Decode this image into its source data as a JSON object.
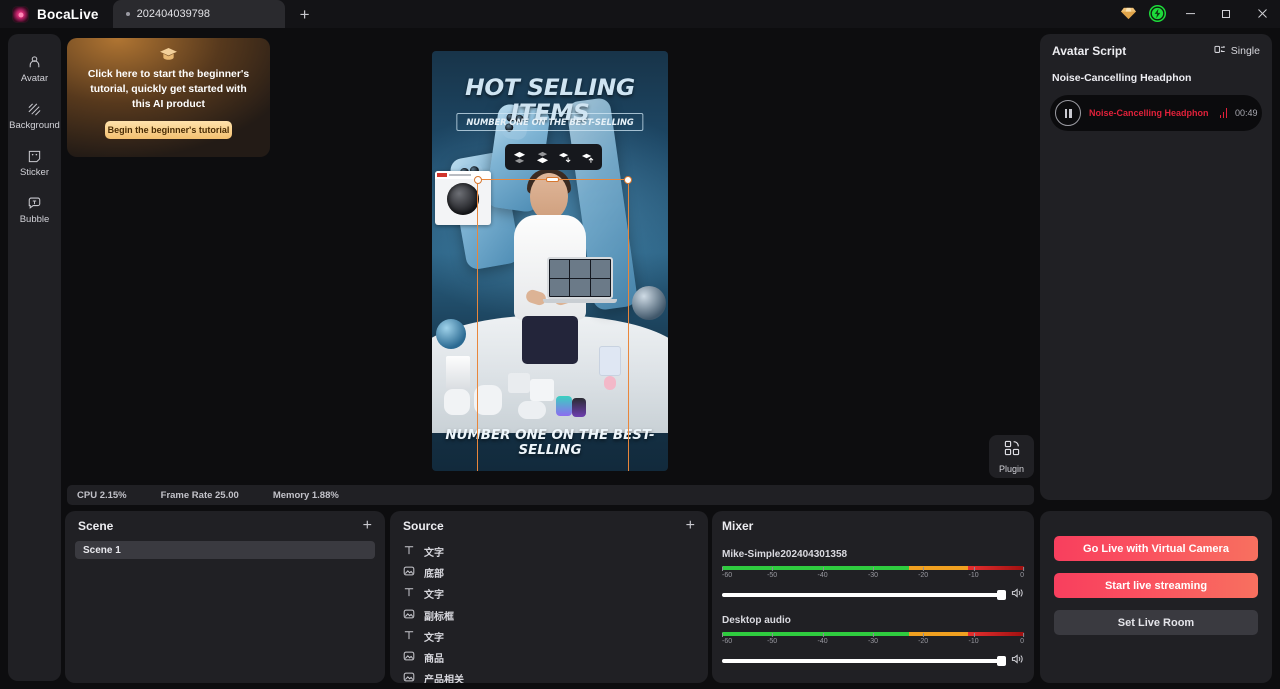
{
  "app": {
    "brand": "BocaLive",
    "tab_label": "202404039798",
    "new_tab_icon": "plus-icon",
    "vip_icon": "vip-diamond-icon",
    "boost_icon": "lightning-bolt-icon",
    "minimize_label": "minimize-icon",
    "maximize_label": "maximize-icon",
    "close_label": "close-icon"
  },
  "rail": {
    "items": [
      {
        "label": "Avatar",
        "icon": "avatar-icon"
      },
      {
        "label": "Background",
        "icon": "background-icon"
      },
      {
        "label": "Sticker",
        "icon": "sticker-icon"
      },
      {
        "label": "Bubble",
        "icon": "bubble-icon"
      }
    ]
  },
  "tutorial": {
    "icon": "graduation-cap-icon",
    "text": "Click here to start the beginner's tutorial, quickly get started with this AI product",
    "button_label": "Begin the beginner's tutorial"
  },
  "canvas": {
    "preview_title": "HOT SELLING ITEMS",
    "preview_subtitle": "NUMBER ONE ON THE BEST-SELLING",
    "preview_bottom": "NUMBER ONE ON THE BEST-SELLING",
    "layer_tools": [
      {
        "name": "bring-to-front-icon"
      },
      {
        "name": "send-to-back-icon"
      },
      {
        "name": "move-layer-down-icon"
      },
      {
        "name": "move-layer-up-icon"
      }
    ]
  },
  "status": {
    "cpu": "CPU 2.15%",
    "frame_rate": "Frame Rate 25.00",
    "memory": "Memory 1.88%"
  },
  "plugin": {
    "label": "Plugin",
    "icon": "plugin-icon"
  },
  "scene": {
    "title": "Scene",
    "add_icon": "plus-icon",
    "items": [
      {
        "label": "Scene 1",
        "selected": true
      }
    ]
  },
  "source": {
    "title": "Source",
    "add_icon": "plus-icon",
    "items": [
      {
        "label": "文字",
        "icon": "text-icon"
      },
      {
        "label": "底部",
        "icon": "image-icon"
      },
      {
        "label": "文字",
        "icon": "text-icon"
      },
      {
        "label": "副标框",
        "icon": "image-icon"
      },
      {
        "label": "文字",
        "icon": "text-icon"
      },
      {
        "label": "商品",
        "icon": "image-icon"
      },
      {
        "label": "产品相关",
        "icon": "image-icon"
      }
    ]
  },
  "mixer": {
    "title": "Mixer",
    "channels": [
      {
        "name": "Mike-Simple202404301358",
        "ticks": [
          "-60",
          "-50",
          "-40",
          "-30",
          "-20",
          "-10",
          "0"
        ],
        "volume_percent": 100,
        "speaker_icon": "speaker-icon"
      },
      {
        "name": "Desktop audio",
        "ticks": [
          "-60",
          "-50",
          "-40",
          "-30",
          "-20",
          "-10",
          "0"
        ],
        "volume_percent": 100,
        "speaker_icon": "speaker-icon"
      }
    ]
  },
  "script": {
    "title": "Avatar Script",
    "mode_label": "Single",
    "mode_icon": "single-mode-icon",
    "item_title": "Noise-Cancelling Headphon",
    "audio": {
      "label": "Noise-Cancelling Headphon",
      "duration": "00:49",
      "pause_icon": "pause-icon"
    }
  },
  "live": {
    "buttons": [
      {
        "label": "Go Live with Virtual Camera",
        "style": "gradient"
      },
      {
        "label": "Start live streaming",
        "style": "gradient"
      },
      {
        "label": "Set Live Room",
        "style": "grey"
      }
    ]
  },
  "colors": {
    "accent_red": "#f83f5e",
    "accent_orange": "#e8863b",
    "panel_bg": "#202024",
    "app_bg": "#0d0d0f"
  }
}
